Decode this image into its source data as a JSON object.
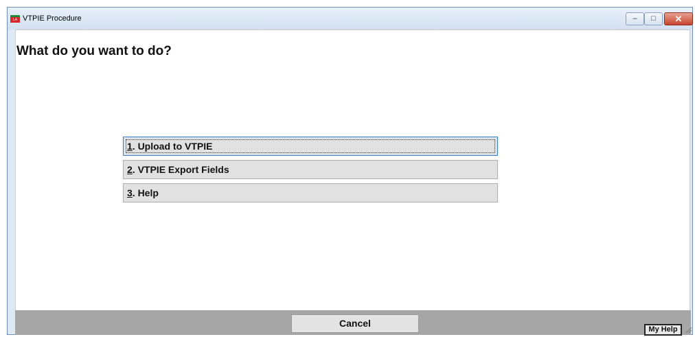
{
  "window": {
    "title": "VTPIE Procedure",
    "icon": "app-icon",
    "icon_text": "LA"
  },
  "heading": "What do you want to do?",
  "menu": [
    {
      "num": "1",
      "rest": ". Upload to VTPIE",
      "focused": true
    },
    {
      "num": "2",
      "rest": ". VTPIE Export Fields",
      "focused": false
    },
    {
      "num": "3",
      "rest": ". Help",
      "focused": false
    }
  ],
  "footer": {
    "cancel_label": "Cancel",
    "myhelp_label": "My Help"
  },
  "colors": {
    "accent": "#3c7fc4",
    "bottom_bar": "#a6a6a6",
    "button": "#e1e1e1"
  }
}
